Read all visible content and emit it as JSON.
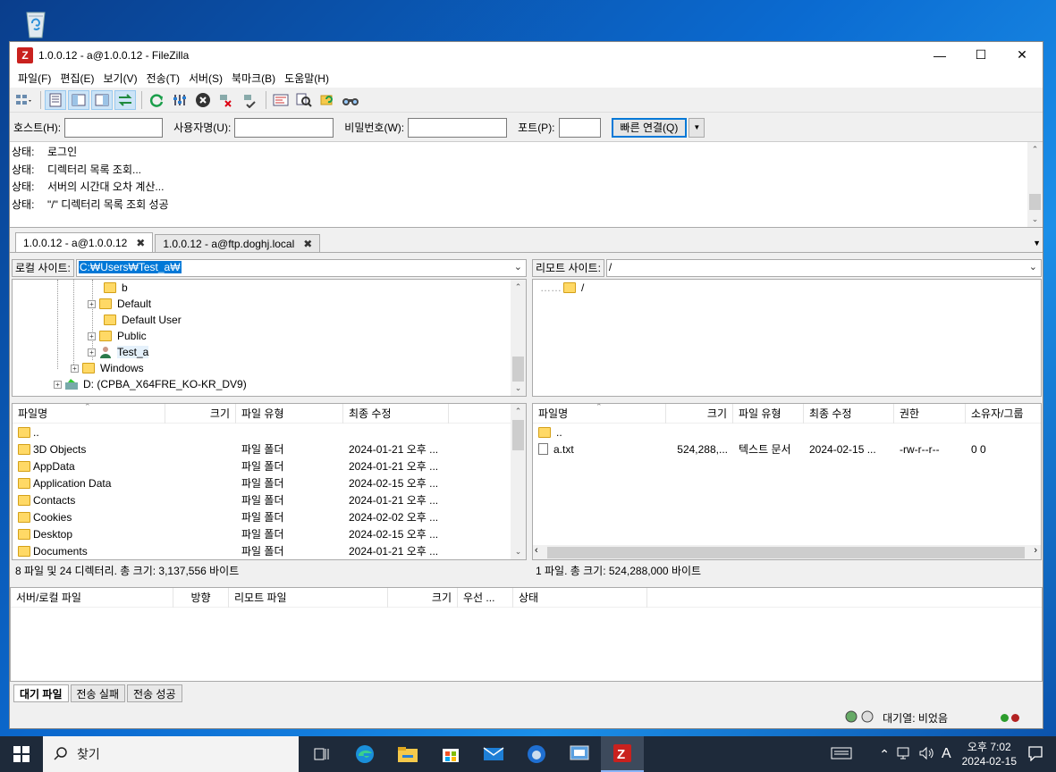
{
  "desktop": {
    "recycle_bin_icon": "recycle-bin-icon"
  },
  "window": {
    "title": "1.0.0.12 - a@1.0.0.12 - FileZilla",
    "app_icon_text": "Z"
  },
  "menu": [
    "파일(F)",
    "편집(E)",
    "보기(V)",
    "전송(T)",
    "서버(S)",
    "북마크(B)",
    "도움말(H)"
  ],
  "quickconnect": {
    "host_label": "호스트(H):",
    "user_label": "사용자명(U):",
    "pass_label": "비밀번호(W):",
    "port_label": "포트(P):",
    "host_value": "",
    "user_value": "",
    "pass_value": "",
    "port_value": "",
    "connect_button": "빠른 연결(Q)"
  },
  "log": [
    "상태:\t로그인",
    "상태:\t디렉터리 목록 조회...",
    "상태:\t서버의 시간대 오차 계산...",
    "상태:\t\"/\" 디렉터리 목록 조회 성공"
  ],
  "tabs": [
    {
      "label": "1.0.0.12 - a@1.0.0.12",
      "close": "✖"
    },
    {
      "label": "1.0.0.12 - a@ftp.doghj.local",
      "close": "✖"
    }
  ],
  "local": {
    "site_label": "로컬 사이트:",
    "path": "C:₩Users₩Test_a₩",
    "tree": [
      "b",
      "Default",
      "Default User",
      "Public",
      "Test_a",
      "Windows",
      "D: (CPBA_X64FRE_KO-KR_DV9)"
    ],
    "columns": [
      "파일명",
      "크기",
      "파일 유형",
      "최종 수정"
    ],
    "files": [
      {
        "name": "..",
        "size": "",
        "type": "",
        "modified": ""
      },
      {
        "name": "3D Objects",
        "size": "",
        "type": "파일 폴더",
        "modified": "2024-01-21 오후 ..."
      },
      {
        "name": "AppData",
        "size": "",
        "type": "파일 폴더",
        "modified": "2024-01-21 오후 ..."
      },
      {
        "name": "Application Data",
        "size": "",
        "type": "파일 폴더",
        "modified": "2024-02-15 오후 ..."
      },
      {
        "name": "Contacts",
        "size": "",
        "type": "파일 폴더",
        "modified": "2024-01-21 오후 ..."
      },
      {
        "name": "Cookies",
        "size": "",
        "type": "파일 폴더",
        "modified": "2024-02-02 오후 ..."
      },
      {
        "name": "Desktop",
        "size": "",
        "type": "파일 폴더",
        "modified": "2024-02-15 오후 ..."
      },
      {
        "name": "Documents",
        "size": "",
        "type": "파일 폴더",
        "modified": "2024-01-21 오후 ..."
      }
    ],
    "status": "8 파일 및 24 디렉터리. 총 크기: 3,137,556 바이트"
  },
  "remote": {
    "site_label": "리모트 사이트:",
    "path": "/",
    "tree": [
      "/"
    ],
    "columns": [
      "파일명",
      "크기",
      "파일 유형",
      "최종 수정",
      "권한",
      "소유자/그룹"
    ],
    "files": [
      {
        "name": "..",
        "size": "",
        "type": "",
        "modified": "",
        "perm": "",
        "owner": ""
      },
      {
        "name": "a.txt",
        "size": "524,288,...",
        "type": "텍스트 문서",
        "modified": "2024-02-15 ...",
        "perm": "-rw-r--r--",
        "owner": "0 0"
      }
    ],
    "status": "1 파일. 총 크기: 524,288,000 바이트"
  },
  "queue": {
    "columns": [
      "서버/로컬 파일",
      "방향",
      "리모트 파일",
      "크기",
      "우선 ...",
      "상태"
    ],
    "tabs": [
      "대기 파일",
      "전송 실패",
      "전송 성공"
    ]
  },
  "statusbar": {
    "queue_text": "대기열: 비었음"
  },
  "taskbar": {
    "search_placeholder": "찾기",
    "clock_time": "오후 7:02",
    "clock_date": "2024-02-15",
    "ime": "A"
  }
}
